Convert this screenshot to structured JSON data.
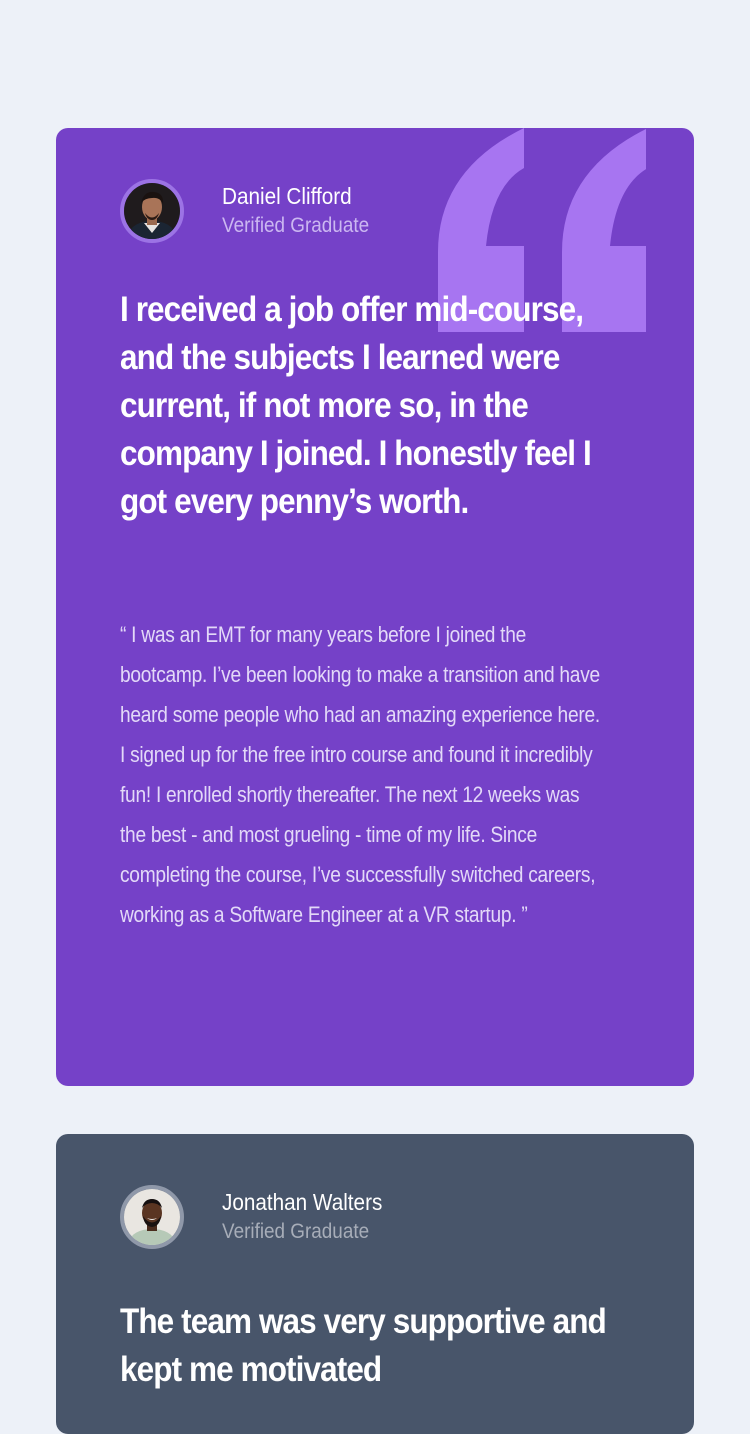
{
  "colors": {
    "page_background": "#edf1f8",
    "card_purple": "#7541c8",
    "card_slate": "#48556a",
    "quote_mark": "#a775f1"
  },
  "testimonials": [
    {
      "name": "Daniel Clifford",
      "status": "Verified Graduate",
      "headline": "I received a job offer mid-course, and the subjects I learned were current, if not more so, in the company I joined. I honestly feel I got every penny’s worth.",
      "body": "“ I was an EMT for many years before I joined the bootcamp. I’ve been looking to make a transition and have heard some people who had an amazing experience here. I signed up for the free intro course and found it incredibly fun! I enrolled shortly thereafter. The next 12 weeks was the best - and most grueling - time of my life. Since completing the course, I’ve successfully switched careers, working as a Software Engineer at a VR startup. ”",
      "avatar_icon": "avatar-daniel-clifford"
    },
    {
      "name": "Jonathan Walters",
      "status": "Verified Graduate",
      "headline": "The team was very supportive and kept me motivated",
      "avatar_icon": "avatar-jonathan-walters"
    }
  ],
  "decorations": {
    "quote_icon": "quotation-mark-icon"
  }
}
